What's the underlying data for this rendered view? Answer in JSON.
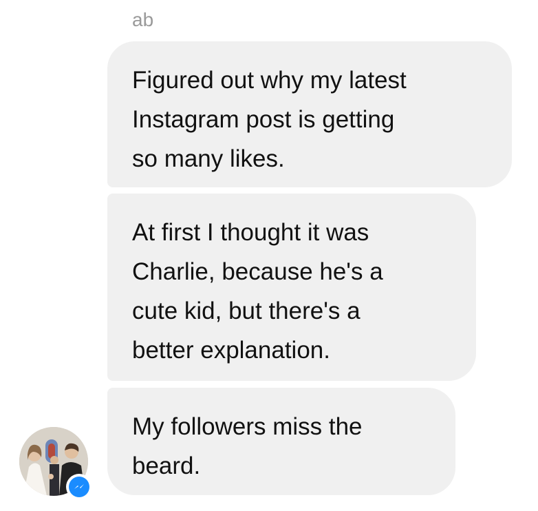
{
  "conversation": {
    "sender_name": "ab",
    "messages": [
      {
        "text": "Figured out why my latest\nInstagram post is getting\nso many likes."
      },
      {
        "text": "At first I thought it was\nCharlie, because he's a\ncute kid, but there's a\nbetter explanation."
      },
      {
        "text": "My followers miss the\nbeard."
      }
    ],
    "avatar_icon": "wedding-photo-avatar",
    "badge_icon": "messenger-icon"
  },
  "colors": {
    "bubble_bg": "#f0f0f0",
    "text": "#111111",
    "sender_name": "#9a9a9a",
    "messenger_blue": "#1a8cff"
  }
}
